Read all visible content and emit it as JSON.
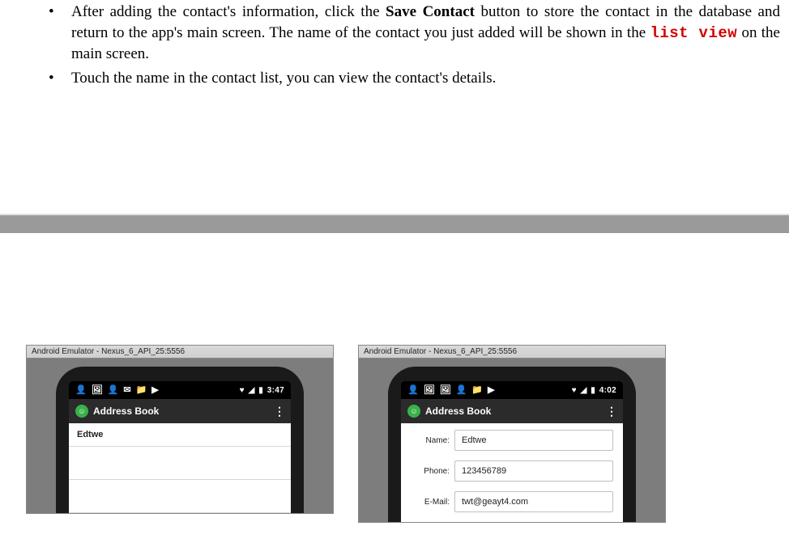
{
  "doc": {
    "bullets": [
      {
        "t1": "After adding the contact's information, click the ",
        "bold1": "Save Contact",
        "t2": " button to store the contact in the database and return to the app's main screen. The name of the contact you just added will be shown in the ",
        "code1": "list view",
        "t3": " on the main screen."
      },
      {
        "t1": "Touch the name in the contact list, you can view the contact's details."
      }
    ]
  },
  "emulator_title": "Android Emulator - Nexus_6_API_25:5556",
  "left_phone": {
    "clock": "3:47",
    "app_title": "Address Book",
    "list": [
      "Edtwe"
    ]
  },
  "right_phone": {
    "clock": "4:02",
    "app_title": "Address Book",
    "fields": {
      "name_label": "Name:",
      "name_value": "Edtwe",
      "phone_label": "Phone:",
      "phone_value": "123456789",
      "email_label": "E-Mail:",
      "email_value": "twt@geayt4.com"
    }
  }
}
